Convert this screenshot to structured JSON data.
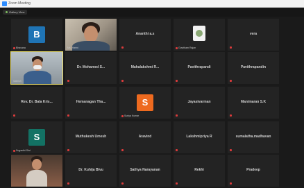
{
  "window": {
    "title": "Zoom Meeting"
  },
  "topbar": {
    "view_label": "Gallery View"
  },
  "colors": {
    "active_border": "#f2e46a",
    "muted": "#d93b3b",
    "tile_bg": "#232323"
  },
  "tiles": [
    {
      "kind": "avatar",
      "letter": "B",
      "avatar_color": "#1f74b5",
      "caption": "Bhavana",
      "muted": true
    },
    {
      "kind": "video",
      "caption": "Ms. Harini",
      "muted": false
    },
    {
      "name": "Ananthi a.s",
      "muted": true
    },
    {
      "kind": "logo",
      "caption": "Gowtham Rajan",
      "muted": true
    },
    {
      "name": "vera",
      "muted": true
    },
    {
      "kind": "video",
      "caption": "Sathish",
      "muted": false,
      "active": true
    },
    {
      "name": "Dr. Mohamed S...",
      "muted": true
    },
    {
      "name": "Mahalakshmi R...",
      "muted": true
    },
    {
      "name": "Pavithrapandi",
      "muted": true
    },
    {
      "name": "Pavithrapandin",
      "muted": true
    },
    {
      "name": "Rev. Dr. Bala Kris...",
      "muted": true
    },
    {
      "name": "Hemanagan Tha...",
      "muted": true
    },
    {
      "kind": "avatar",
      "letter": "S",
      "avatar_color": "#ee6a1f",
      "caption": "Suriya Kumar",
      "muted": true
    },
    {
      "name": "Jayasivarman",
      "muted": true
    },
    {
      "name": "Manimaran S.K",
      "muted": true
    },
    {
      "kind": "avatar",
      "letter": "S",
      "avatar_color": "#137264",
      "caption": "Suganthi Shri",
      "muted": true
    },
    {
      "name": "Muthukesh Umesh",
      "muted": true
    },
    {
      "name": "Aravind",
      "muted": true
    },
    {
      "name": "Lakshmipriya R",
      "muted": true
    },
    {
      "name": "sumalatha.madhavan",
      "muted": true
    },
    {
      "kind": "video",
      "caption": "",
      "muted": false
    },
    {
      "name": "Dr. Kuhija Bivu",
      "muted": true
    },
    {
      "name": "Sathya Narayanan",
      "muted": true
    },
    {
      "name": "Rekhi",
      "muted": true
    },
    {
      "name": "Pradeep",
      "muted": true
    }
  ]
}
